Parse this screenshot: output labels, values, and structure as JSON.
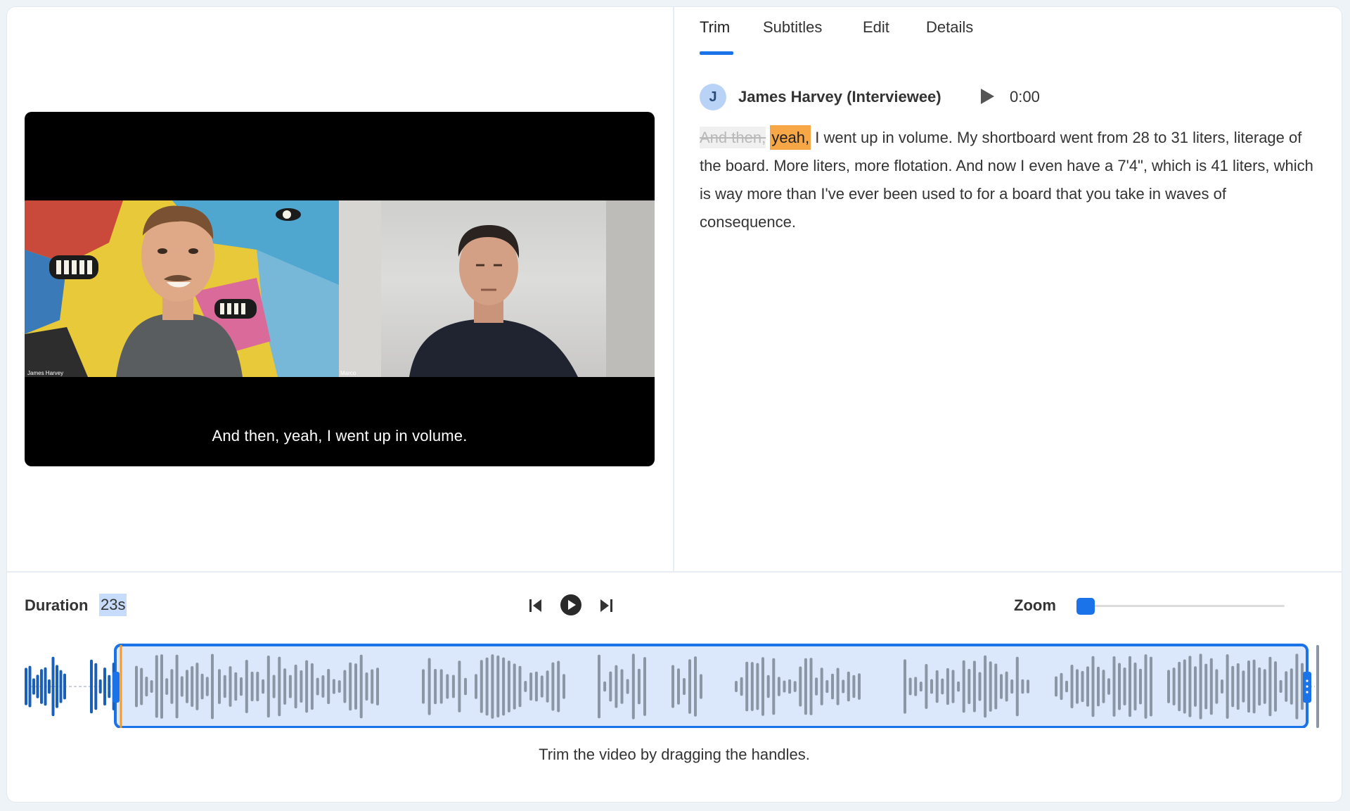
{
  "tabs": [
    {
      "label": "Trim",
      "active": true
    },
    {
      "label": "Subtitles",
      "active": false
    },
    {
      "label": "Edit",
      "active": false
    },
    {
      "label": "Details",
      "active": false
    }
  ],
  "speaker": {
    "initial": "J",
    "name": "James Harvey (Interviewee)",
    "time": "0:00"
  },
  "transcript": {
    "removed": "And then,",
    "current": "yeah,",
    "rest": " I went up in volume. My shortboard went from 28 to 31 liters, literage of the board. More liters, more flotation. And now I even have a 7'4\", which is 41 liters, which is way more than I've ever been used to for a board that you take in waves of consequence."
  },
  "video": {
    "caption": "And then, yeah, I went up in volume.",
    "participants": [
      "James Harvey",
      "Marco"
    ]
  },
  "timeline": {
    "duration_label": "Duration",
    "duration_value": "23s",
    "zoom_label": "Zoom",
    "zoom_level": 0.04,
    "hint": "Trim the video by dragging the handles."
  },
  "colors": {
    "accent": "#1a73e8",
    "highlight": "#f7a745",
    "selection": "#dbe8fb",
    "waveform_active": "#8a96a3",
    "waveform_outside": "#1a5fb8",
    "playhead": "#f59a23"
  },
  "icons": {
    "skip_back": "skip-back-icon",
    "play": "play-icon",
    "skip_forward": "skip-forward-icon",
    "speaker_play": "play-icon"
  }
}
